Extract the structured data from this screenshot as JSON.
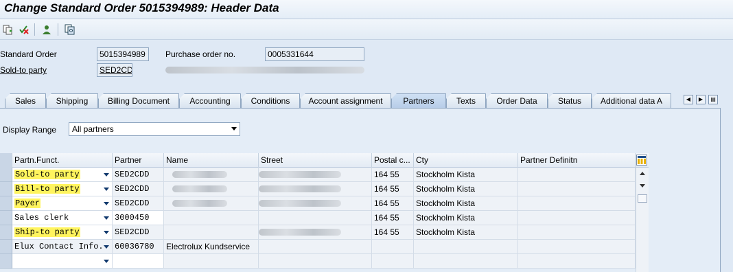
{
  "window": {
    "title": "Change Standard Order 5015394989: Header Data"
  },
  "toolbar": {
    "icons": [
      "display-document-flow-icon",
      "cancel-check-icon",
      "user-icon",
      "copy-overview-icon"
    ]
  },
  "header": {
    "standard_order_label": "Standard Order",
    "standard_order_value": "5015394989",
    "po_label": "Purchase order no.",
    "po_value": "0005331644",
    "sold_to_label": "Sold-to party",
    "sold_to_value": "SED2CDD"
  },
  "tabs": [
    {
      "label": "Sales",
      "active": false
    },
    {
      "label": "Shipping",
      "active": false
    },
    {
      "label": "Billing Document",
      "active": false
    },
    {
      "label": "Accounting",
      "active": false
    },
    {
      "label": "Conditions",
      "active": false
    },
    {
      "label": "Account assignment",
      "active": false
    },
    {
      "label": "Partners",
      "active": true
    },
    {
      "label": "Texts",
      "active": false
    },
    {
      "label": "Order Data",
      "active": false
    },
    {
      "label": "Status",
      "active": false
    },
    {
      "label": "Additional data A",
      "active": false
    }
  ],
  "display_range": {
    "label": "Display Range",
    "value": "All partners"
  },
  "grid": {
    "columns": [
      "Partn.Funct.",
      "Partner",
      "Name",
      "Street",
      "Postal c...",
      "Cty",
      "Partner Definitn"
    ],
    "rows": [
      {
        "func": "Sold-to party",
        "partner": "SED2CDD",
        "name": "",
        "street": "",
        "postal": "164 55",
        "city": "Stockholm Kista",
        "definition": "",
        "highlight": true
      },
      {
        "func": "Bill-to party",
        "partner": "SED2CDD",
        "name": "",
        "street": "",
        "postal": "164 55",
        "city": "Stockholm Kista",
        "definition": "",
        "highlight": true
      },
      {
        "func": "Payer",
        "partner": "SED2CDD",
        "name": "",
        "street": "",
        "postal": "164 55",
        "city": "Stockholm Kista",
        "definition": "",
        "highlight": true
      },
      {
        "func": "Sales clerk",
        "partner": "3000450",
        "name": "",
        "street": "",
        "postal": "164 55",
        "city": "Stockholm Kista",
        "definition": "",
        "highlight": false
      },
      {
        "func": "Ship-to party",
        "partner": "SED2CDD",
        "name": "",
        "street": "",
        "postal": "164 55",
        "city": "Stockholm Kista",
        "definition": "",
        "highlight": true
      },
      {
        "func": "Elux Contact Info.",
        "partner": "60036780",
        "name": "Electrolux Kundservice",
        "street": "",
        "postal": "",
        "city": "",
        "definition": "",
        "highlight": false
      },
      {
        "func": "",
        "partner": "",
        "name": "",
        "street": "",
        "postal": "",
        "city": "",
        "definition": "",
        "highlight": false
      }
    ]
  },
  "colors": {
    "highlight": "#fff45e",
    "background": "#dfe9f5",
    "accent": "#8ea5c0"
  }
}
